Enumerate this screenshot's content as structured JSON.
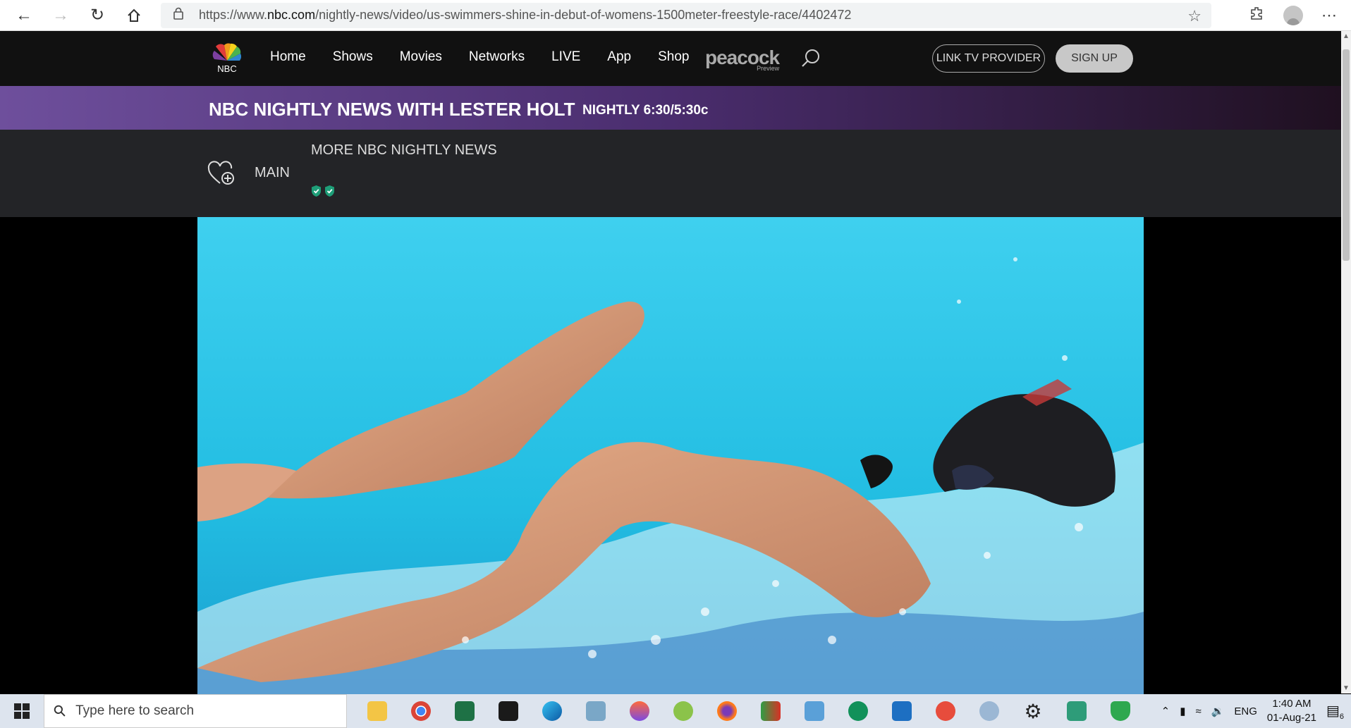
{
  "browser": {
    "url_prefix": "https://www.",
    "url_domain": "nbc.com",
    "url_path": "/nightly-news/video/us-swimmers-shine-in-debut-of-womens-1500meter-freestyle-race/4402472"
  },
  "site_nav": {
    "logo_text": "NBC",
    "links": [
      "Home",
      "Shows",
      "Movies",
      "Networks",
      "LIVE",
      "App",
      "Shop"
    ],
    "peacock": "peacock",
    "peacock_sub": "Preview",
    "link_tv": "LINK TV PROVIDER",
    "sign_up": "SIGN UP"
  },
  "show": {
    "title": "NBC NIGHTLY NEWS WITH LESTER HOLT",
    "time": "NIGHTLY 6:30/5:30c"
  },
  "sub_nav": {
    "main": "MAIN",
    "more": "MORE NBC NIGHTLY NEWS"
  },
  "taskbar": {
    "search_placeholder": "Type here to search",
    "lang": "ENG",
    "time": "1:40 AM",
    "date": "01-Aug-21",
    "notifications": "6"
  },
  "colors": {
    "band_start": "#6e4f9c",
    "band_end": "#1f1020",
    "pool": "#28c5e6"
  }
}
